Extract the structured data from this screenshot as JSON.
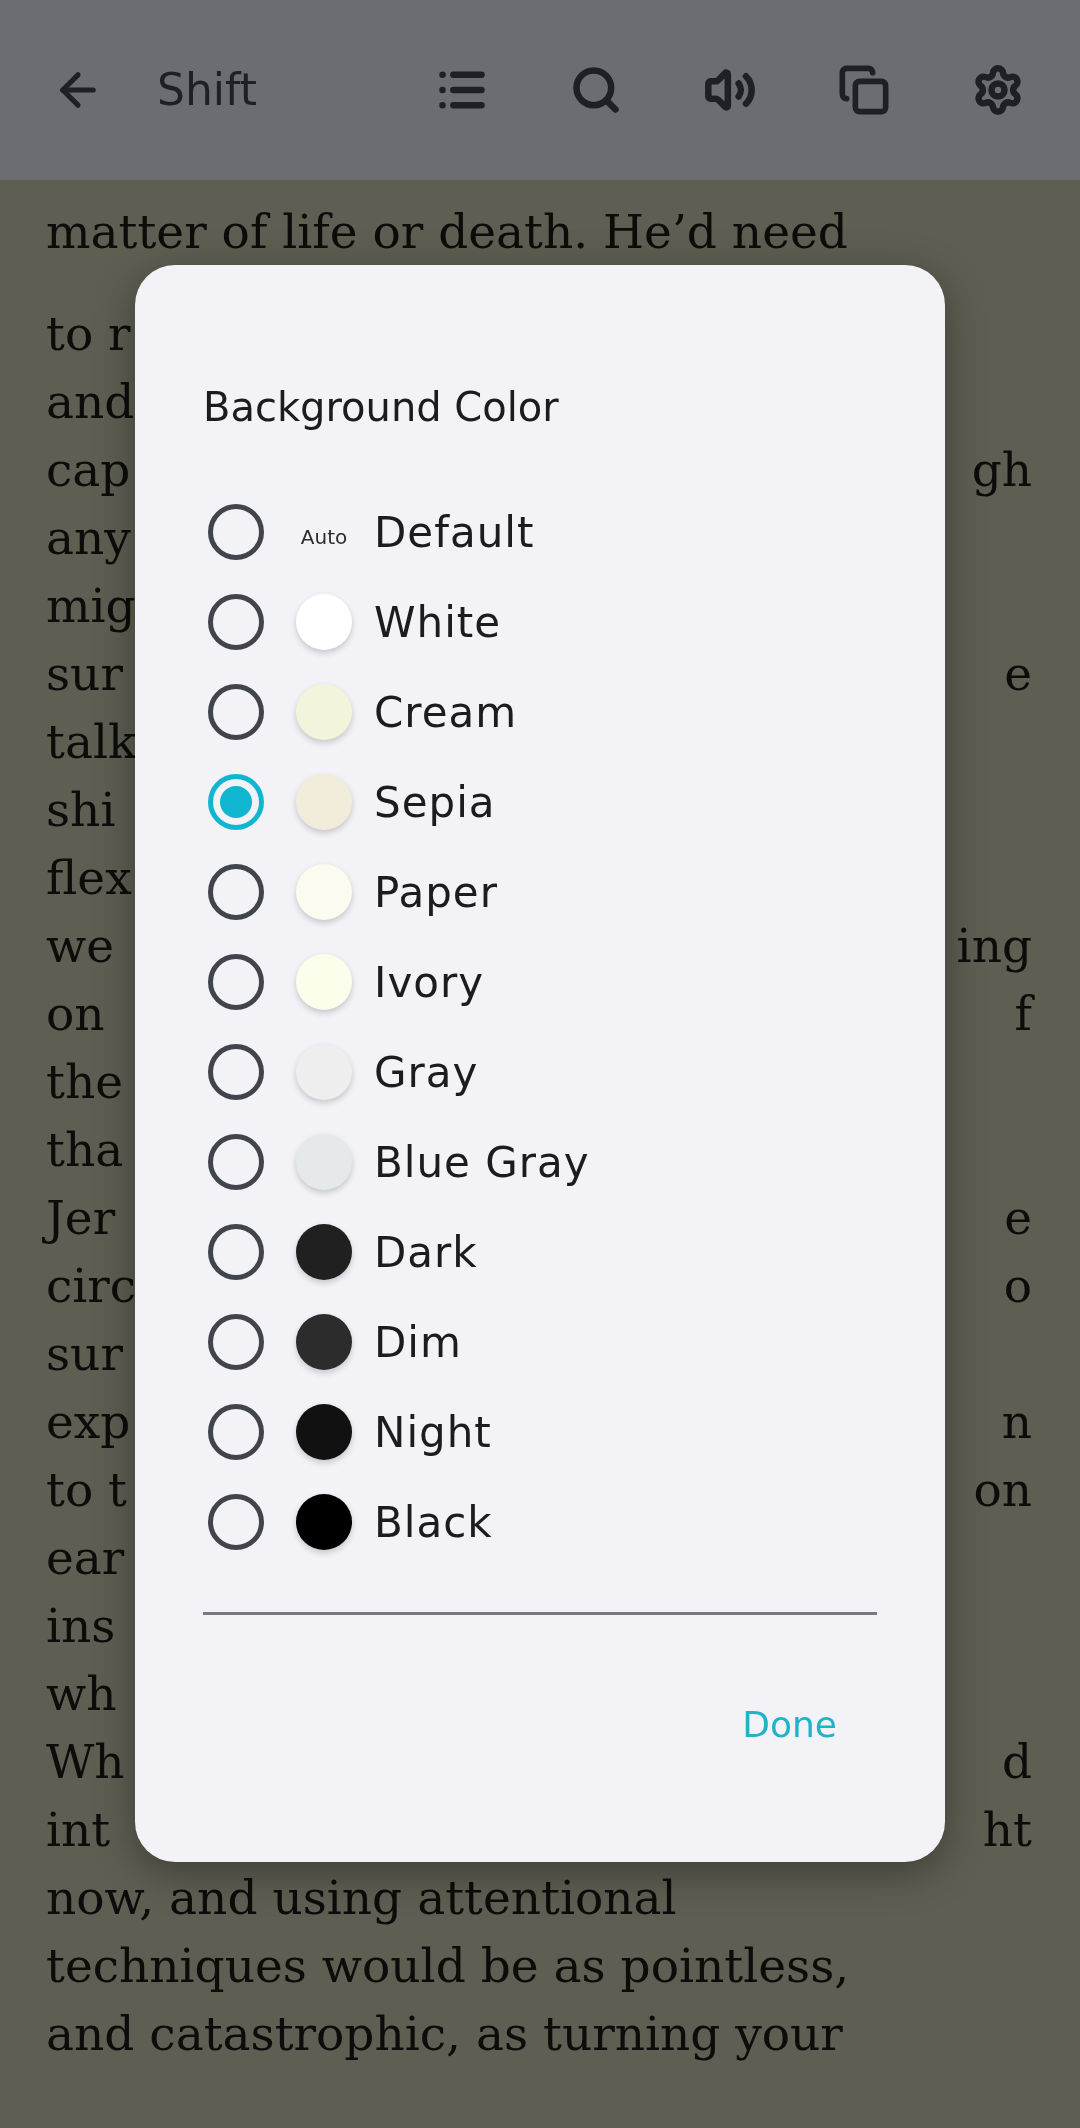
{
  "toolbar": {
    "title": "Shift"
  },
  "book": {
    "lines": [
      {
        "left": "matter of life or death. He’d need"
      },
      {
        "left": "to r"
      },
      {
        "left": "and"
      },
      {
        "left": "cap",
        "right": "gh"
      },
      {
        "left": "any"
      },
      {
        "left": "mig"
      },
      {
        "left": "sur",
        "right": "e"
      },
      {
        "left": "talk"
      },
      {
        "left": "shi"
      },
      {
        "left": "flex"
      },
      {
        "left": "we",
        "right": "ing"
      },
      {
        "left": "on",
        "right": "f"
      },
      {
        "left": "the"
      },
      {
        "left": "tha"
      },
      {
        "left": "Jer",
        "right": "e"
      },
      {
        "left": "circ",
        "right": "o"
      },
      {
        "left": "sur"
      },
      {
        "left": "exp",
        "right": "n"
      },
      {
        "left": "to t",
        "right": "on"
      },
      {
        "left": "ear"
      },
      {
        "left": "ins"
      },
      {
        "left": "wh"
      },
      {
        "left": "Wh",
        "right": "d"
      },
      {
        "left": "int",
        "right": "ht"
      },
      {
        "left": "now, and using attentional"
      },
      {
        "left": "techniques would be as pointless,"
      },
      {
        "left": "and catastrophic, as turning your"
      }
    ]
  },
  "dialog": {
    "title": "Background Color",
    "options": [
      {
        "label": "Default",
        "kind": "auto",
        "swatch_text": "Auto",
        "selected": false
      },
      {
        "label": "White",
        "kind": "swatch",
        "color": "#ffffff",
        "selected": false
      },
      {
        "label": "Cream",
        "kind": "swatch",
        "color": "#f3f4dc",
        "selected": false
      },
      {
        "label": "Sepia",
        "kind": "swatch",
        "color": "#f2ecdb",
        "selected": true
      },
      {
        "label": "Paper",
        "kind": "swatch",
        "color": "#fcfbef",
        "selected": false
      },
      {
        "label": "Ivory",
        "kind": "swatch",
        "color": "#fafeea",
        "selected": false
      },
      {
        "label": "Gray",
        "kind": "swatch",
        "color": "#eeeeee",
        "selected": false
      },
      {
        "label": "Blue Gray",
        "kind": "swatch",
        "color": "#e6e9ec",
        "selected": false
      },
      {
        "label": "Dark",
        "kind": "swatch",
        "color": "#202020",
        "selected": false
      },
      {
        "label": "Dim",
        "kind": "swatch",
        "color": "#2c2c2c",
        "selected": false
      },
      {
        "label": "Night",
        "kind": "swatch",
        "color": "#111111",
        "selected": false
      },
      {
        "label": "Black",
        "kind": "swatch",
        "color": "#000000",
        "selected": false
      }
    ],
    "button": "Done"
  }
}
